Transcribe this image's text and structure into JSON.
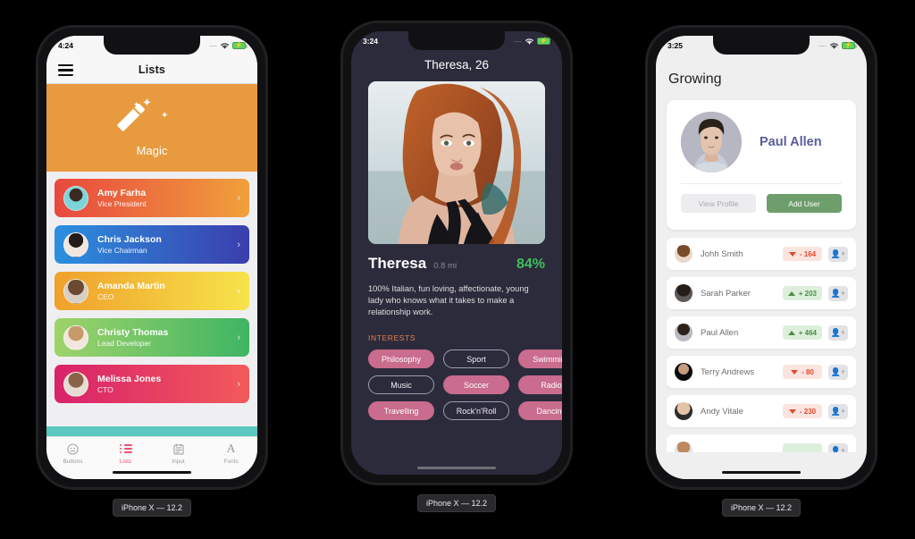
{
  "devices": [
    {
      "label": "iPhone X — 12.2",
      "status": {
        "time": "4:24",
        "dots": "....",
        "wifi": "wifi-icon",
        "battery": "battery-charging-icon"
      },
      "nav": {
        "menu": "menu-icon",
        "title": "Lists"
      },
      "banner": {
        "icon": "magic-wand-icon",
        "label": "Magic"
      },
      "list": [
        {
          "name": "Amy Farha",
          "role": "Vice President",
          "chevron": "›"
        },
        {
          "name": "Chris Jackson",
          "role": "Vice Chairman",
          "chevron": "›"
        },
        {
          "name": "Amanda Martin",
          "role": "CEO",
          "chevron": "›"
        },
        {
          "name": "Christy Thomas",
          "role": "Lead Developer",
          "chevron": "›"
        },
        {
          "name": "Melissa Jones",
          "role": "CTO",
          "chevron": "›"
        }
      ],
      "tabs": [
        {
          "label": "Buttons",
          "icon": "smiley-icon",
          "active": false
        },
        {
          "label": "Lists",
          "icon": "list-icon",
          "active": true
        },
        {
          "label": "Input",
          "icon": "form-input-icon",
          "active": false
        },
        {
          "label": "Fonts",
          "icon": "letter-a-icon",
          "active": false
        }
      ],
      "accent": "#F34E6F",
      "banner_color": "#E89B3E",
      "strip_color": "#5DC8C2"
    },
    {
      "label": "iPhone X — 12.2",
      "status": {
        "time": "3:24",
        "dots": "....",
        "wifi": "wifi-icon",
        "battery": "battery-charging-icon"
      },
      "header": "Theresa, 26",
      "photo": "profile-photo",
      "profile": {
        "name": "Theresa",
        "distance": "0.8 mi",
        "match": "84%",
        "bio": "100% Italian, fun loving, affectionate, young lady who knows what it takes to make a relationship work.",
        "interests_label": "INTERESTS"
      },
      "tags": [
        {
          "text": "Philosophy",
          "style": "fill"
        },
        {
          "text": "Sport",
          "style": "out"
        },
        {
          "text": "Swimming",
          "style": "fill"
        },
        {
          "text": "Music",
          "style": "out"
        },
        {
          "text": "Soccer",
          "style": "fill"
        },
        {
          "text": "Radio",
          "style": "fill"
        },
        {
          "text": "Travelling",
          "style": "fill"
        },
        {
          "text": "Rock'n'Roll",
          "style": "out"
        },
        {
          "text": "Dancing",
          "style": "fill"
        }
      ],
      "match_color": "#3FBF5E",
      "tag_color": "#C96C8D",
      "bg": "#2C2B3C"
    },
    {
      "label": "iPhone X — 12.2",
      "status": {
        "time": "3:25",
        "dots": "....",
        "wifi": "wifi-icon",
        "battery": "battery-charging-icon"
      },
      "title": "Growing",
      "card": {
        "name": "Paul Allen",
        "avatar": "user-avatar",
        "buttons": [
          {
            "label": "View Profile",
            "style": "ghost"
          },
          {
            "label": "Add User",
            "style": "green"
          }
        ]
      },
      "rows": [
        {
          "name": "Johh Smith",
          "value": "- 164",
          "dir": "down"
        },
        {
          "name": "Sarah Parker",
          "value": "+ 203",
          "dir": "up"
        },
        {
          "name": "Paul Allen",
          "value": "+ 464",
          "dir": "up"
        },
        {
          "name": "Terry Andrews",
          "value": "- 80",
          "dir": "down"
        },
        {
          "name": "Andy Vitale",
          "value": "- 230",
          "dir": "down"
        },
        {
          "name": "",
          "value": "",
          "dir": "up"
        }
      ],
      "name_color": "#5B5D9B",
      "up_color": "#4C8C46",
      "down_color": "#E0492D"
    }
  ]
}
